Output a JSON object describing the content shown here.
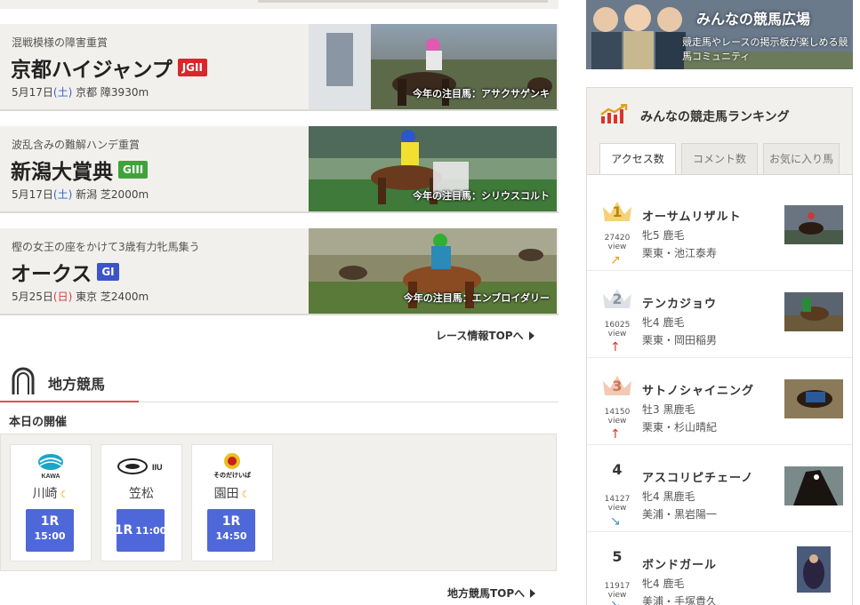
{
  "races": [
    {
      "sub": "混戦模様の障害重賞",
      "name": "京都ハイジャンプ",
      "grade": "JGII",
      "grade_color": "#d9262b",
      "date": "5月17日",
      "weekday": "(土)",
      "venue_course": "京都 障3930m",
      "caption": "今年の注目馬：アサクサゲンキ"
    },
    {
      "sub": "波乱含みの難解ハンデ重賞",
      "name": "新潟大賞典",
      "grade": "GIII",
      "grade_color": "#3fa33a",
      "date": "5月17日",
      "weekday": "(土)",
      "venue_course": "新潟 芝2000m",
      "caption": "今年の注目馬：シリウスコルト"
    },
    {
      "sub": "樫の女王の座をかけて3歳有力牝馬集う",
      "name": "オークス",
      "grade": "GI",
      "grade_color": "#3c54c8",
      "date": "5月25日",
      "weekday": "(日)",
      "venue_course": "東京 芝2400m",
      "caption": "今年の注目馬：エンブロイダリー"
    }
  ],
  "race_info_link": "レース情報TOPへ",
  "chiho": {
    "title": "地方競馬",
    "today": "本日の開催",
    "venues": [
      {
        "name": "川崎",
        "logo": "KAWASAKI",
        "race": "1R",
        "time": "15:00",
        "night": true
      },
      {
        "name": "笠松",
        "logo": "KASAMATSU",
        "race": "1R",
        "time": "11:00",
        "night": false
      },
      {
        "name": "園田",
        "logo": "そのだけいば",
        "race": "1R",
        "time": "14:50",
        "night": true
      }
    ],
    "top_link": "地方競馬TOPへ"
  },
  "banner": {
    "title": "みんなの競馬広場",
    "subtitle": "競走馬やレースの掲示板が楽しめる競馬コミュニティ"
  },
  "ranking": {
    "title": "みんなの競走馬ランキング",
    "tabs": [
      "アクセス数",
      "コメント数",
      "お気に入り馬"
    ],
    "items": [
      {
        "rank": "1",
        "views": "27420",
        "unit": "view",
        "trend": "↗",
        "trend_color": "#e0a020",
        "name": "オーサムリザルト",
        "sex": "牝5 鹿毛",
        "trainer": "栗東・池江泰寿"
      },
      {
        "rank": "2",
        "views": "16025",
        "unit": "view",
        "trend": "↑",
        "trend_color": "#d9342b",
        "name": "テンカジョウ",
        "sex": "牝4 鹿毛",
        "trainer": "栗東・岡田稲男"
      },
      {
        "rank": "3",
        "views": "14150",
        "unit": "view",
        "trend": "↑",
        "trend_color": "#d9342b",
        "name": "サトノシャイニング",
        "sex": "牡3 黒鹿毛",
        "trainer": "栗東・杉山晴紀"
      },
      {
        "rank": "4",
        "views": "14127",
        "unit": "view",
        "trend": "↘",
        "trend_color": "#4a90c8",
        "name": "アスコリピチェーノ",
        "sex": "牝4 黒鹿毛",
        "trainer": "美浦・黒岩陽一"
      },
      {
        "rank": "5",
        "views": "11917",
        "unit": "view",
        "trend": "↘",
        "trend_color": "#4a90c8",
        "name": "ボンドガール",
        "sex": "牝4 鹿毛",
        "trainer": "美浦・手塚貴久"
      }
    ]
  }
}
